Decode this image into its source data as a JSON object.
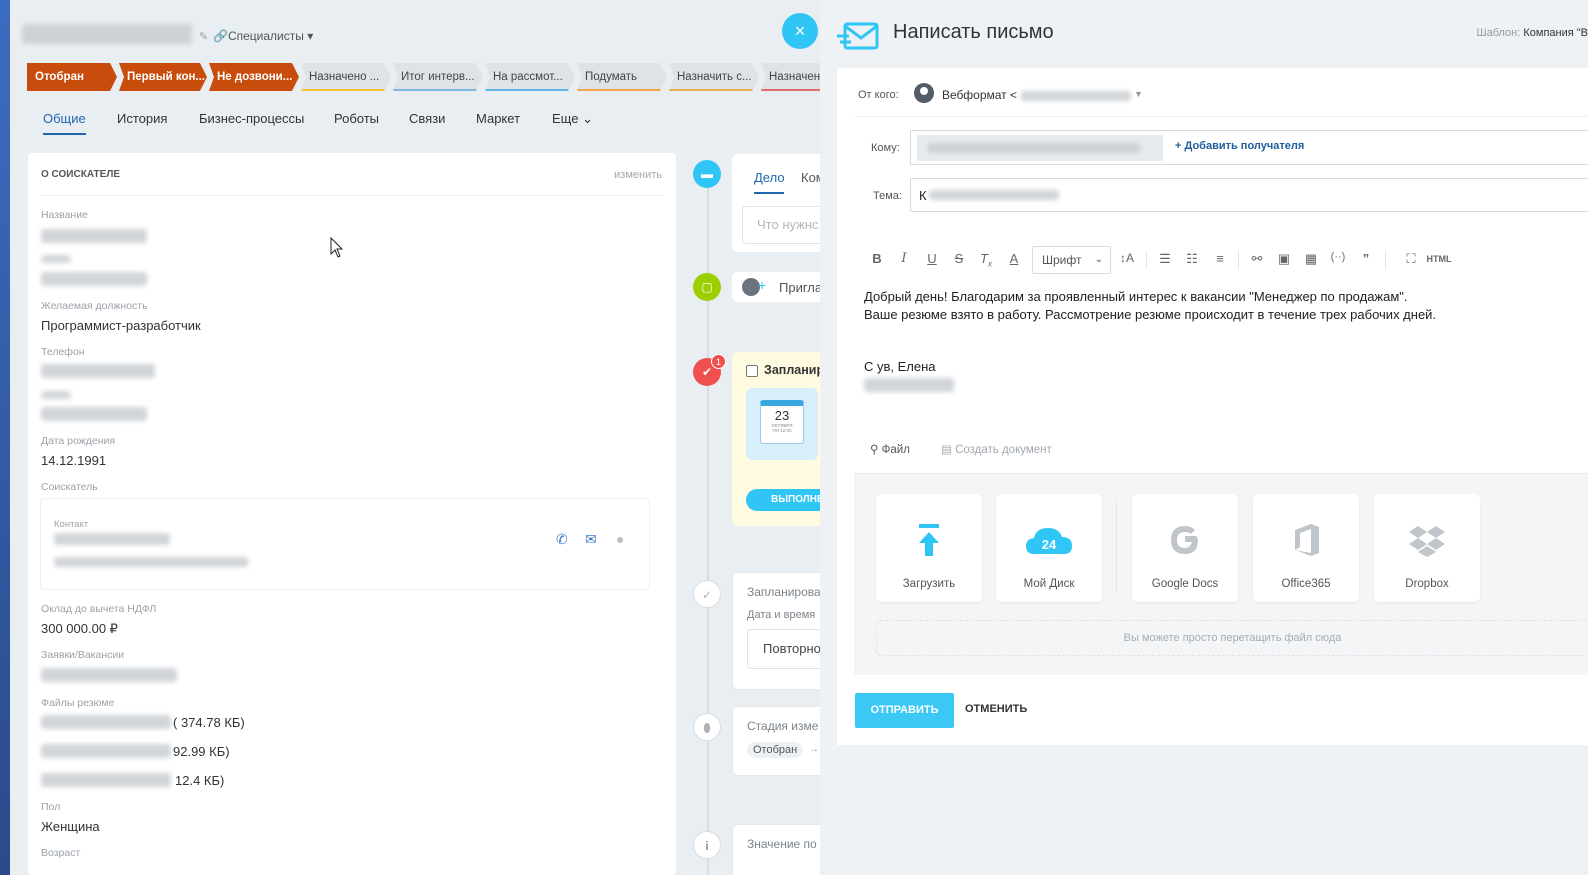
{
  "left": {
    "breadcrumb": "Специалисты",
    "close_icon": "×",
    "stages": [
      {
        "label": "Отобран",
        "state": "done",
        "line": "#c84c0c"
      },
      {
        "label": "Первый кон...",
        "state": "done",
        "line": "#c84c0c"
      },
      {
        "label": "Не дозвони...",
        "state": "done",
        "line": "#c84c0c"
      },
      {
        "label": "Назначено ...",
        "state": "todo",
        "line": "#f1c232"
      },
      {
        "label": "Итог интерв...",
        "state": "todo",
        "line": "#7fb6e0"
      },
      {
        "label": "На рассмот...",
        "state": "todo",
        "line": "#5db7e8"
      },
      {
        "label": "Подумать",
        "state": "todo",
        "line": "#f2a54a"
      },
      {
        "label": "Назначить с...",
        "state": "todo",
        "line": "#e9b04a"
      },
      {
        "label": "Назначено",
        "state": "todo",
        "line": "#e26b6b"
      }
    ],
    "tabs": [
      "Общие",
      "История",
      "Бизнес-процессы",
      "Роботы",
      "Связи",
      "Маркет",
      "Еще"
    ],
    "about": {
      "title": "О СОИСКАТЕЛЕ",
      "edit": "изменить",
      "name_label": "Название",
      "position_label": "Желаемая должность",
      "position_value": "Программист-разработчик",
      "phone_label": "Телефон",
      "birth_label": "Дата рождения",
      "birth_value": "14.12.1991",
      "applicant_label": "Соискатель",
      "contact_label": "Контакт",
      "salary_label": "Оклад до вычета НДФЛ",
      "salary_value": "300 000.00 ₽",
      "vacancy_label": "Заявки/Вакансии",
      "files_label": "Файлы резюме",
      "files": [
        "( 374.78 КБ)",
        "92.99 КБ)",
        "12.4 КБ)"
      ],
      "gender_label": "Пол",
      "gender_value": "Женщина",
      "age_label": "Возраст"
    },
    "timeline": {
      "tab_deal": "Дело",
      "tab_comment": "Ком",
      "placeholder": "Что нужнс",
      "invite": "Пригла",
      "planned": "Запланир",
      "cal_day": "23",
      "cal_month": "ОКТЯБРЯ",
      "cal_time": "ПН 12:00",
      "done_btn": "ВЫПОЛНЕ",
      "planned2": "Запланирова",
      "date_time": "Дата и время",
      "repeat": "Повторно",
      "stage_changed": "Стадия изме",
      "stage_from": "Отобран",
      "arrow": "→",
      "value": "Значение по",
      "badge": "1"
    }
  },
  "email": {
    "title": "Написать письмо",
    "template_label": "Шаблон:",
    "template_value": "Компания \"В",
    "from_label": "От кого:",
    "from_value": "Вебформат <",
    "to_label": "Кому:",
    "add_recipient": "+ Добавить получателя",
    "subject_label": "Тема:",
    "subject_prefix": "К",
    "font_select": "Шрифт",
    "toolbar_html": "HTML",
    "body_lines": [
      "Добрый день! Благодарим за проявленный интерес к вакансии \"Менеджер по продажам\".",
      "Ваше резюме взято в работу. Рассмотрение резюме происходит в течение трех рабочих дней."
    ],
    "signature": "С ув, Елена",
    "file_link": "Файл",
    "create_doc": "Создать документ",
    "sources": [
      "Загрузить",
      "Мой Диск",
      "Google Docs",
      "Office365",
      "Dropbox"
    ],
    "disk_badge": "24",
    "drop_hint": "Вы можете просто перетащить файл сюда",
    "send": "ОТПРАВИТЬ",
    "cancel": "ОТМЕНИТЬ"
  },
  "colors": {
    "accent": "#3bc8f5",
    "done_stage": "#c84c0c",
    "link": "#2067b0"
  }
}
